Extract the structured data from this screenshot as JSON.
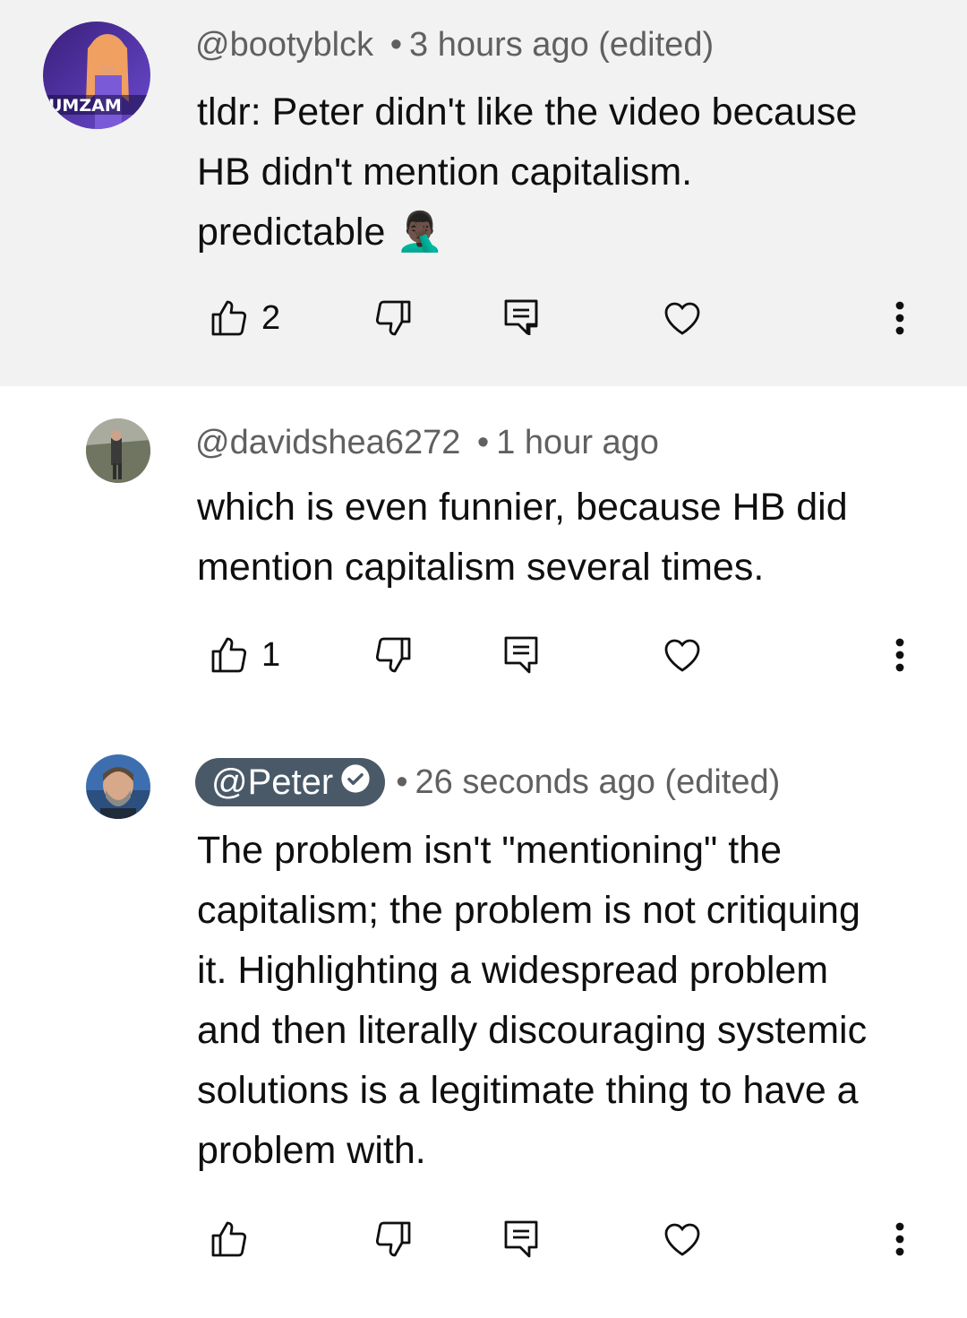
{
  "comments": [
    {
      "avatar_text": "UMZAM",
      "handle": "@bootyblck",
      "separator": "•",
      "time": "3 hours ago (edited)",
      "body": [
        "tldr: Peter didn't like the video because",
        "HB didn't mention capitalism.",
        "predictable 🤦🏿‍♂️"
      ],
      "likes": "2"
    },
    {
      "handle": "@davidshea6272",
      "separator": "•",
      "time": "1 hour ago",
      "body": [
        "which is even funnier, because HB did",
        "mention capitalism several times."
      ],
      "likes": "1"
    },
    {
      "handle": "@Peter",
      "verified_icon": "check-circle-icon",
      "separator": "•",
      "time": "26 seconds ago (edited)",
      "body": [
        "The problem isn't \"mentioning\" the",
        "capitalism; the problem is not critiquing",
        "it. Highlighting a widespread problem",
        "and then literally discouraging systemic",
        "solutions is a legitimate thing to have a",
        "problem with."
      ],
      "likes": ""
    }
  ],
  "icons": {
    "like": "thumbs-up-icon",
    "dislike": "thumbs-down-icon",
    "reply": "reply-comment-icon",
    "heart": "heart-icon",
    "more": "more-vertical-icon"
  },
  "colors": {
    "highlight_bg": "#f2f2f2",
    "meta_text": "#606060",
    "author_badge_bg": "#4a5968"
  }
}
